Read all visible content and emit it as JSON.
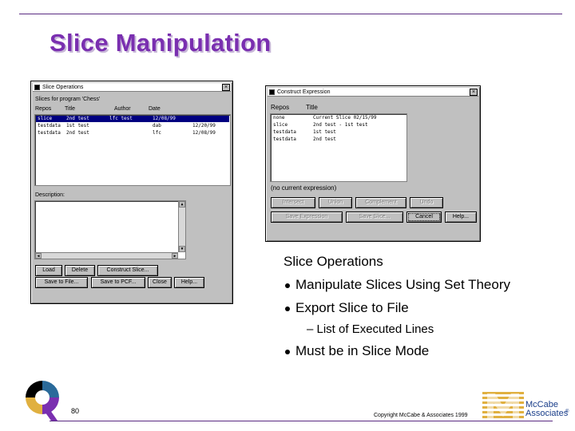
{
  "slide": {
    "title": "Slice Manipulation",
    "page_number": "80",
    "copyright": "Copyright McCabe & Associates 1999"
  },
  "brand": {
    "line1": "McCabe",
    "line2": "Associates",
    "registered": "®",
    "color": "#1a3e8a",
    "accent_colors": [
      "#2a6a9a",
      "#e0b040",
      "#000000",
      "#7a2fb0"
    ]
  },
  "slice_ops_window": {
    "title": "Slice Operations",
    "close_glyph": "×",
    "program_label": "Slices for program 'Chess'",
    "columns": [
      "Repos",
      "Title",
      "Author",
      "Date"
    ],
    "rows": [
      {
        "repos": "slice",
        "title": "2nd test",
        "author": "lfc test",
        "date": "12/08/99",
        "selected": true
      },
      {
        "repos": "testdata",
        "title": "1st test",
        "author": "dab",
        "date": "12/20/99",
        "selected": false
      },
      {
        "repos": "testdata",
        "title": "2nd test",
        "author": "lfc",
        "date": "12/08/99",
        "selected": false
      }
    ],
    "description_label": "Description:",
    "buttons_row1": [
      "Load",
      "Delete",
      "Construct Slice..."
    ],
    "buttons_row2": [
      "Save to File...",
      "Save to PCF...",
      "Close",
      "Help..."
    ]
  },
  "construct_window": {
    "title": "Construct Expression",
    "close_glyph": "×",
    "columns": [
      "Repos",
      "Title"
    ],
    "rows": [
      {
        "repos": "none",
        "title": "Current Slice 02/15/99"
      },
      {
        "repos": "slice",
        "title": "2nd test - 1st test"
      },
      {
        "repos": "testdata",
        "title": "1st test"
      },
      {
        "repos": "testdata",
        "title": "2nd test"
      }
    ],
    "expression_status": "(no current expression)",
    "buttons_row1": [
      "Intersect",
      "Union",
      "Complement",
      "Undo"
    ],
    "buttons_row2": [
      "Save Expression",
      "Save Slice...",
      "Cancel",
      "Help..."
    ]
  },
  "bullets": {
    "heading": "Slice Operations",
    "items": [
      "Manipulate Slices Using Set Theory",
      "Export Slice to File"
    ],
    "sub_item": "– List of Executed Lines",
    "last_item": "Must be in Slice Mode"
  }
}
